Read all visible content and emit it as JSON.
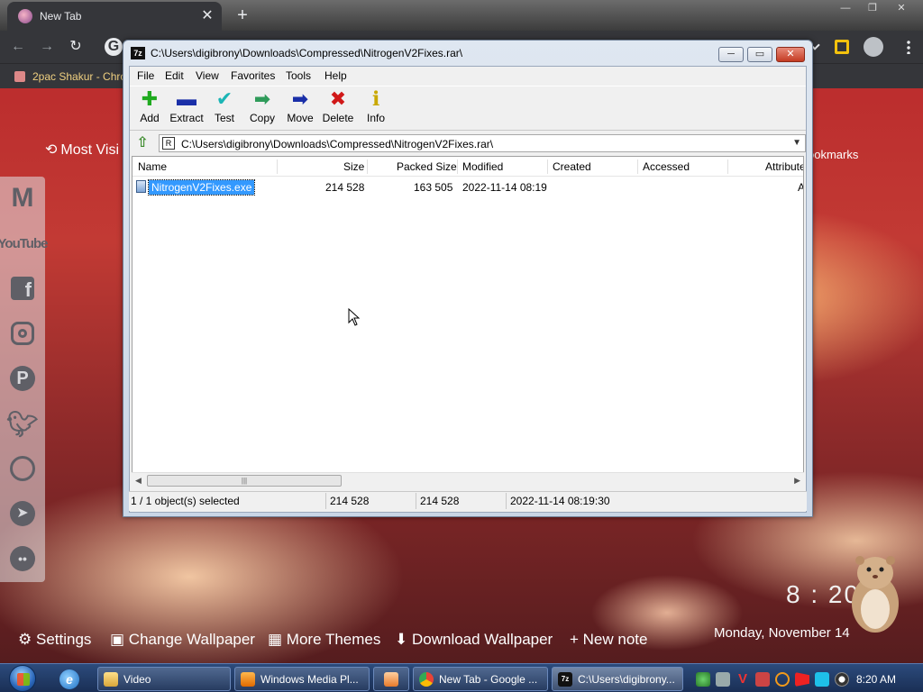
{
  "browser": {
    "tab_title": "New Tab",
    "tab_close": "✕",
    "new_tab": "+",
    "bookmark_label": "2pac Shakur - Chro",
    "google_letter": "G",
    "window_controls": [
      "—",
      "❐",
      "✕"
    ]
  },
  "newtab": {
    "most_visited": "Most Visi",
    "bookmarks": "ookmarks",
    "social": [
      "gmail-icon",
      "youtube-icon",
      "facebook-icon",
      "instagram-icon",
      "pinterest-icon",
      "twitter-icon",
      "whatsapp-icon",
      "telegram-icon",
      "reddit-icon"
    ],
    "youtube_label": "YouTube",
    "bottom": {
      "settings": "Settings",
      "change_wallpaper": "Change Wallpaper",
      "more_themes": "More Themes",
      "download_wallpaper": "Download Wallpaper",
      "new_note": "+ New note"
    },
    "clock": "8 : 20",
    "date": "Monday, November 14"
  },
  "zip": {
    "title": "C:\\Users\\digibrony\\Downloads\\Compressed\\NitrogenV2Fixes.rar\\",
    "app_badge": "7z",
    "menu": [
      "File",
      "Edit",
      "View",
      "Favorites",
      "Tools",
      "Help"
    ],
    "toolbar": [
      {
        "label": "Add",
        "icon": "add-icon",
        "color": "#1faa1f",
        "glyph": "✚"
      },
      {
        "label": "Extract",
        "icon": "extract-icon",
        "color": "#1a2fa8",
        "glyph": "▬"
      },
      {
        "label": "Test",
        "icon": "test-icon",
        "color": "#1bb5b5",
        "glyph": "✔"
      },
      {
        "label": "Copy",
        "icon": "copy-icon",
        "color": "#2f9b5a",
        "glyph": "➡"
      },
      {
        "label": "Move",
        "icon": "move-icon",
        "color": "#1a2fa8",
        "glyph": "➡"
      },
      {
        "label": "Delete",
        "icon": "delete-icon",
        "color": "#d01818",
        "glyph": "✖"
      },
      {
        "label": "Info",
        "icon": "info-icon",
        "color": "#c9a800",
        "glyph": "ℹ"
      }
    ],
    "address": "C:\\Users\\digibrony\\Downloads\\Compressed\\NitrogenV2Fixes.rar\\",
    "address_badge": "R",
    "columns": [
      "Name",
      "Size",
      "Packed Size",
      "Modified",
      "Created",
      "Accessed",
      "Attribute"
    ],
    "files": [
      {
        "name": "NitrogenV2Fixes.exe",
        "size": "214 528",
        "packed": "163 505",
        "modified": "2022-11-14 08:19",
        "created": "",
        "accessed": "",
        "attr": "A"
      }
    ],
    "status": {
      "selected": "1 / 1 object(s) selected",
      "size": "214 528",
      "packed": "214 528",
      "modified": "2022-11-14 08:19:30"
    },
    "scroll_grip": "|||"
  },
  "taskbar": {
    "tasks": [
      "Video",
      "Windows Media Pl...",
      "",
      "New Tab - Google ...",
      "C:\\Users\\digibrony..."
    ],
    "clock": "8:20 AM"
  }
}
